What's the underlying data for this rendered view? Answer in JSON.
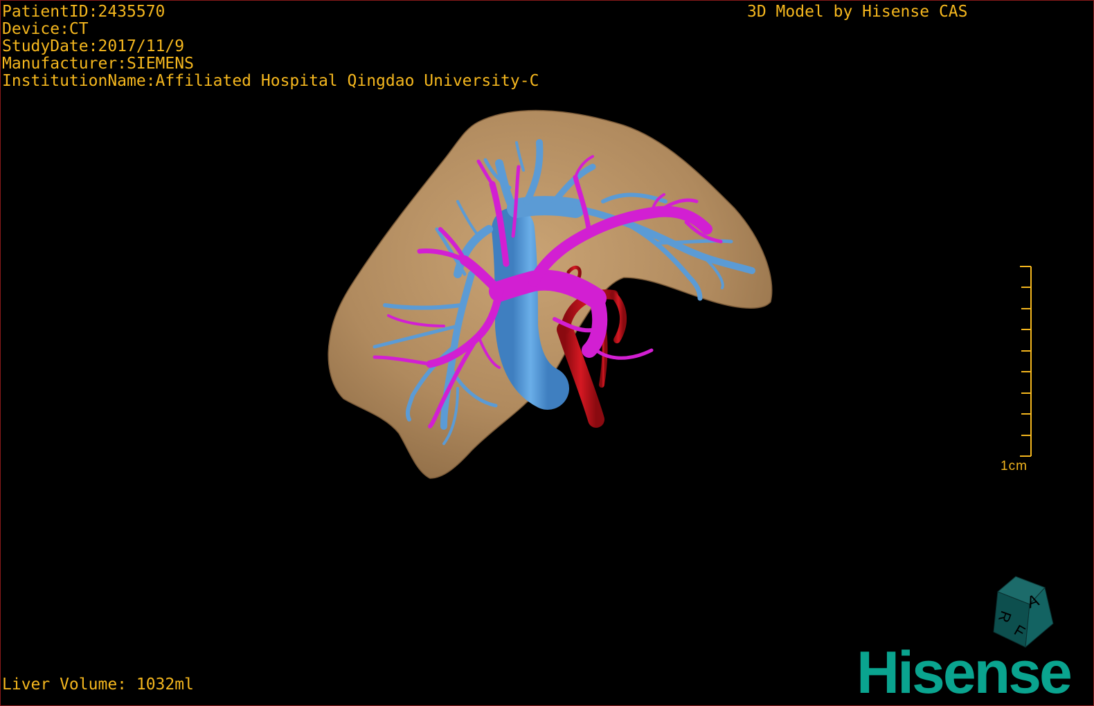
{
  "header": {
    "patient_id": "PatientID:2435570",
    "device": "Device:CT",
    "study_date": "StudyDate:2017/11/9",
    "manufacturer": "Manufacturer:SIEMENS",
    "institution": "InstitutionName:Affiliated Hospital Qingdao University-C",
    "model_credit": "3D Model by Hisense CAS"
  },
  "footer": {
    "liver_volume": "Liver Volume: 1032ml"
  },
  "scale_bar": {
    "label": "1cm"
  },
  "orientation_cube": {
    "face_letters": [
      "A",
      "R",
      "F"
    ]
  },
  "brand": {
    "logo_text": "Hisense"
  },
  "colors": {
    "overlay_text": "#f5b71e",
    "liver": "#b08a5e",
    "hepatic_vein": "#5b9bd5",
    "portal_vein": "#d21fd2",
    "artery": "#c4101a",
    "brand": "#0aa48f",
    "frame": "#8a1a1a"
  }
}
